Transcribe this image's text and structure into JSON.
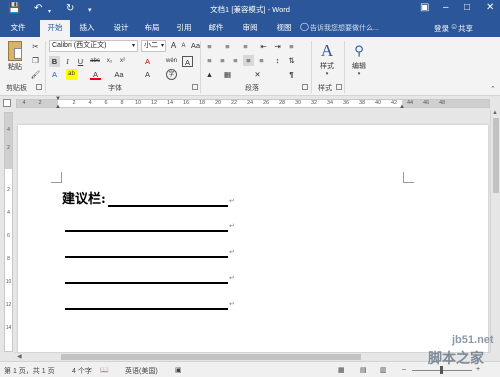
{
  "window": {
    "title": "文档1 [兼容模式] - Word"
  },
  "tabs": [
    "文件",
    "开始",
    "插入",
    "设计",
    "布局",
    "引用",
    "邮件",
    "审阅",
    "视图"
  ],
  "tell_me": "告诉我您想要做什么...",
  "account": {
    "login": "登录",
    "share": "共享"
  },
  "ribbon": {
    "clipboard": {
      "label": "剪贴板",
      "paste": "粘贴"
    },
    "font": {
      "label": "字体",
      "font_name": "Calibri (西文正文)",
      "font_size": "小二",
      "bold": "B",
      "italic": "I",
      "underline": "U",
      "strike": "abc",
      "subscript": "x₂",
      "superscript": "x²",
      "change_case": "Aa",
      "clear": "A",
      "font_color": "A",
      "grow": "A",
      "shrink": "A",
      "phonetic": "wén",
      "border_char": "A"
    },
    "paragraph": {
      "label": "段落"
    },
    "styles": {
      "label": "样式",
      "button": "样式"
    },
    "editing": {
      "button": "编辑"
    }
  },
  "ruler": {
    "ticks": [
      "4",
      "2",
      "2",
      "4",
      "6",
      "8",
      "10",
      "12",
      "14",
      "16",
      "18",
      "20",
      "22",
      "24",
      "26",
      "28",
      "30",
      "32",
      "34",
      "36",
      "38",
      "40",
      "42",
      "44",
      "46",
      "48"
    ]
  },
  "vruler": {
    "ticks": [
      "4",
      "2",
      "2",
      "4",
      "6",
      "8",
      "10",
      "12",
      "14"
    ]
  },
  "document": {
    "heading": "建议栏:",
    "para_mark": "↵",
    "line_count": 4
  },
  "status": {
    "page": "第 1 页，共 1 页",
    "words": "4 个字",
    "language": "英语(美国)",
    "zoom": "+"
  },
  "watermark": {
    "url": "jb51.net",
    "text": "脚本之家"
  },
  "colors": {
    "brand": "#2b579a",
    "ribbon": "#f3f3f3"
  }
}
